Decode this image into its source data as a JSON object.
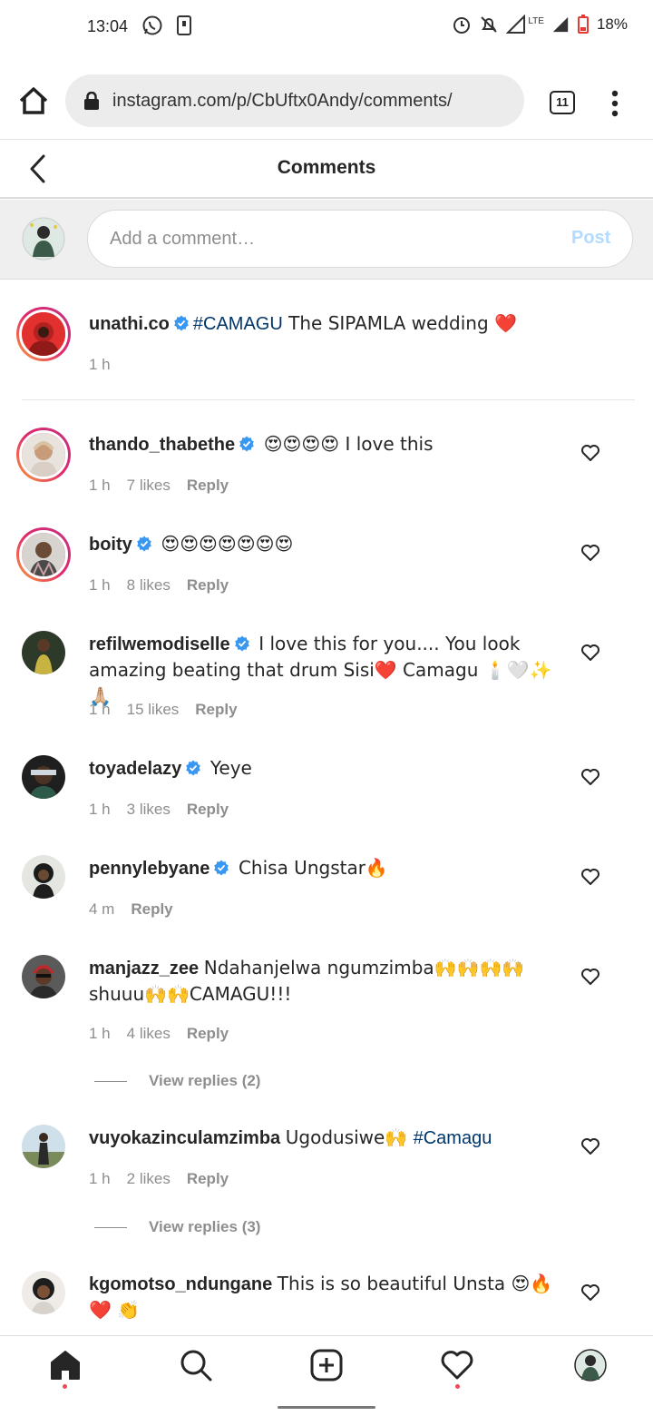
{
  "status_bar": {
    "time": "13:04",
    "battery": "18%",
    "network": "LTE"
  },
  "browser": {
    "url": "instagram.com/p/CbUftx0Andy/comments/",
    "tab_count": "11"
  },
  "header": {
    "title": "Comments"
  },
  "composer": {
    "placeholder": "Add a comment…",
    "post_label": "Post"
  },
  "caption": {
    "username": "unathi.co",
    "verified": true,
    "hashtag": "#CAMAGU",
    "text": " The SIPAMLA wedding ❤️",
    "time": "1 h"
  },
  "comments": [
    {
      "username": "thando_thabethe",
      "verified": true,
      "text": "😍😍😍😍 I love this",
      "time": "1 h",
      "likes": "7 likes",
      "reply": "Reply"
    },
    {
      "username": "boity",
      "verified": true,
      "text": "😍😍😍😍😍😍😍",
      "time": "1 h",
      "likes": "8 likes",
      "reply": "Reply"
    },
    {
      "username": "refilwemodiselle",
      "verified": true,
      "text": "I love this for you.... You look amazing beating that drum Sisi❤️ Camagu 🕯️🤍✨🙏🏼",
      "time": "1 h",
      "likes": "15 likes",
      "reply": "Reply"
    },
    {
      "username": "toyadelazy",
      "verified": true,
      "text": "Yeye",
      "time": "1 h",
      "likes": "3 likes",
      "reply": "Reply"
    },
    {
      "username": "pennylebyane",
      "verified": true,
      "text": "Chisa Ungstar🔥",
      "time": "4 m",
      "likes": "",
      "reply": "Reply"
    },
    {
      "username": "manjazz_zee",
      "verified": false,
      "text": "Ndahanjelwa ngumzimba🙌🙌🙌🙌 shuuu🙌🙌CAMAGU!!!",
      "time": "1 h",
      "likes": "4 likes",
      "reply": "Reply",
      "view_replies": "View replies (2)"
    },
    {
      "username": "vuyokazinculamzimba",
      "verified": false,
      "text": "Ugodusiwe🙌 ",
      "hashtag": "#Camagu",
      "time": "1 h",
      "likes": "2 likes",
      "reply": "Reply",
      "view_replies": "View replies (3)"
    },
    {
      "username": "kgomotso_ndungane",
      "verified": false,
      "text": "This is so beautiful Unsta 😍🔥❤️ 👏"
    }
  ],
  "colors": {
    "accent": "#0095f6",
    "hashtag": "#00376b",
    "notification_dot": "#ed4956",
    "verified": "#3897f0"
  },
  "nav_icons": [
    "home-icon",
    "search-icon",
    "new-post-icon",
    "activity-heart-icon",
    "profile-avatar"
  ]
}
